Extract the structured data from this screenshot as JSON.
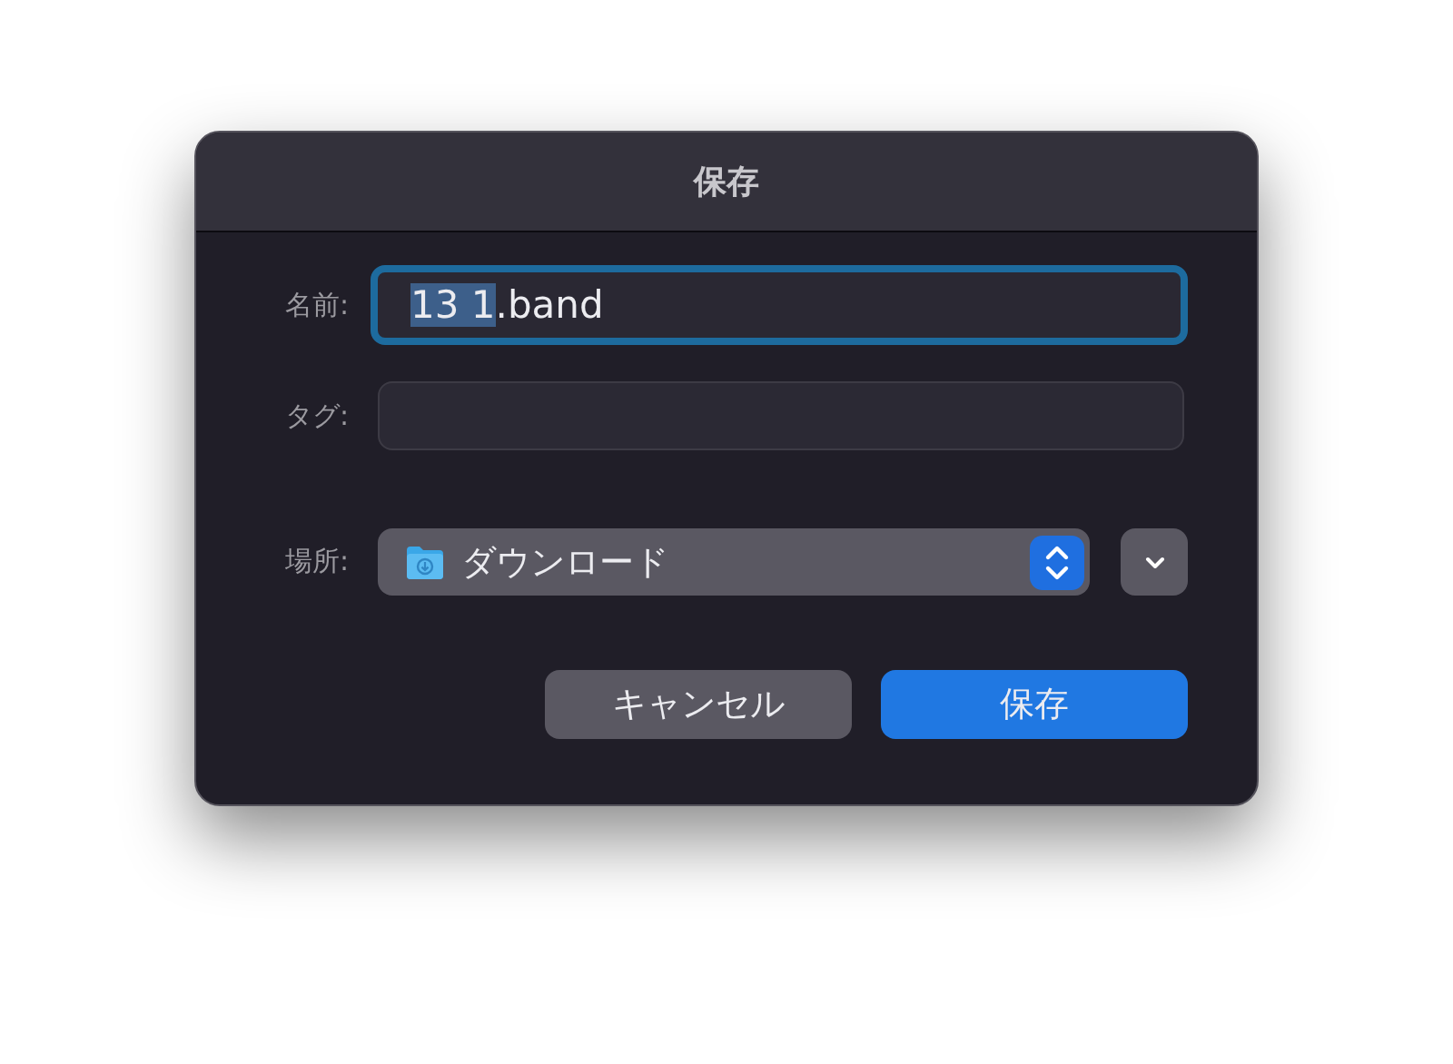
{
  "window": {
    "title": "保存"
  },
  "name_row": {
    "label": "名前:",
    "selected_text": "13 1",
    "value_rest": ".band",
    "focused": true
  },
  "tags_row": {
    "label": "タグ:"
  },
  "location_row": {
    "label": "場所:",
    "value": "ダウンロード",
    "expanded": false
  },
  "buttons": [
    {
      "label": "キャンセル",
      "kind": "secondary"
    },
    {
      "label": "保存",
      "kind": "primary"
    }
  ]
}
